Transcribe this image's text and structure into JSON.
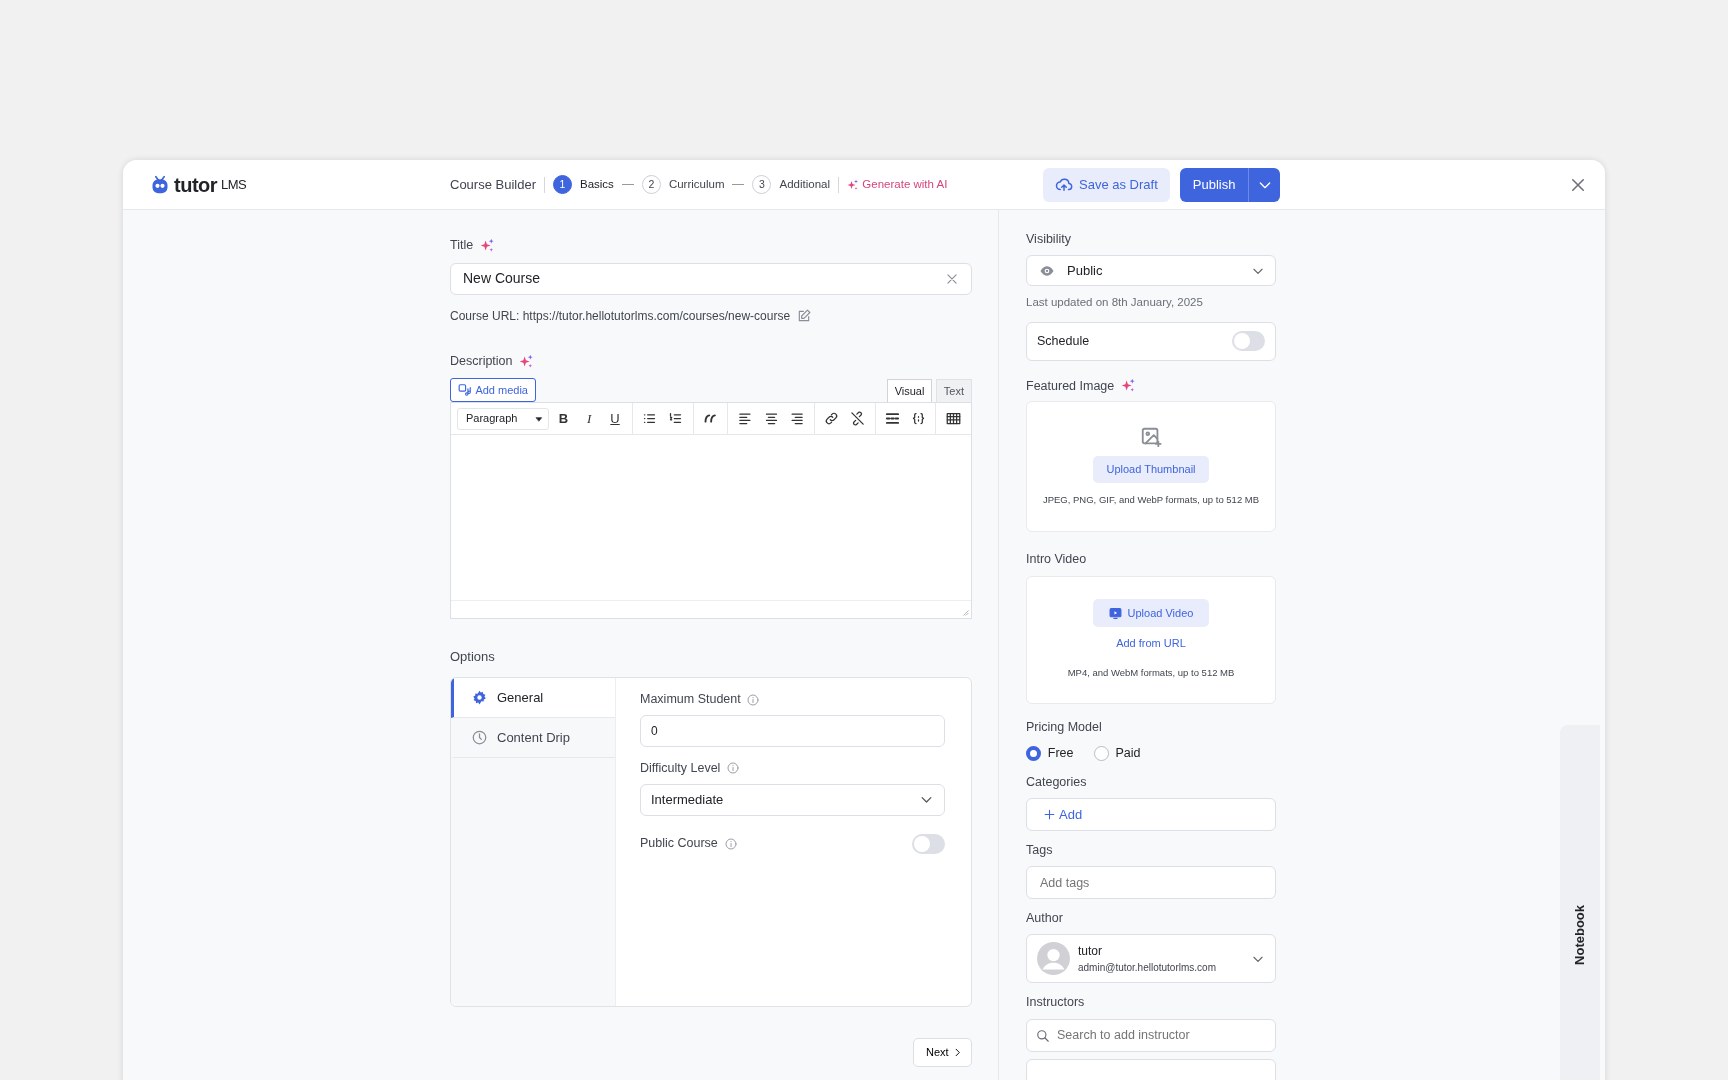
{
  "header": {
    "logo": "tutor",
    "logo_suffix": "LMS",
    "title": "Course Builder",
    "steps": [
      {
        "number": "1",
        "label": "Basics",
        "selected": true
      },
      {
        "number": "2",
        "label": "Curriculum",
        "selected": false
      },
      {
        "number": "3",
        "label": "Additional",
        "selected": false
      }
    ],
    "ai_button": "Generate with AI",
    "save_draft": "Save as Draft",
    "publish": "Publish"
  },
  "main": {
    "title_label": "Title",
    "title_value": "New Course",
    "course_url": "Course URL: https://tutor.hellotutorlms.com/courses/new-course",
    "description_label": "Description",
    "add_media": "Add media",
    "editor_tabs": [
      {
        "label": "Visual",
        "selected": true
      },
      {
        "label": "Text",
        "selected": false
      }
    ],
    "format_select": "Paragraph",
    "format_buttons": [
      "B",
      "I",
      "U"
    ],
    "options_label": "Options",
    "option_tabs": [
      {
        "label": "General",
        "selected": true
      },
      {
        "label": "Content Drip",
        "selected": false
      }
    ],
    "max_student_label": "Maximum Student",
    "max_student_value": "0",
    "difficulty_label": "Difficulty Level",
    "difficulty_value": "Intermediate",
    "public_course_label": "Public Course",
    "public_course_on": false,
    "next_button": "Next"
  },
  "sidebar": {
    "visibility_label": "Visibility",
    "visibility_value": "Public",
    "last_updated": "Last updated on 8th January, 2025",
    "schedule_label": "Schedule",
    "schedule_on": false,
    "featured_image_label": "Featured Image",
    "upload_thumbnail": "Upload Thumbnail",
    "image_formats": "JPEG, PNG, GIF, and WebP formats, up to 512 MB",
    "intro_video_label": "Intro Video",
    "upload_video": "Upload Video",
    "add_from_url": "Add from URL",
    "video_formats": "MP4, and WebM formats, up to 512 MB",
    "pricing_label": "Pricing Model",
    "pricing_options": [
      {
        "label": "Free",
        "selected": true
      },
      {
        "label": "Paid",
        "selected": false
      }
    ],
    "categories_label": "Categories",
    "categories_add": "Add",
    "tags_label": "Tags",
    "tags_placeholder": "Add tags",
    "author_label": "Author",
    "author_name": "tutor",
    "author_email": "admin@tutor.hellotutorlms.com",
    "instructors_label": "Instructors",
    "instructors_placeholder": "Search to add instructor"
  },
  "notebook_tab": "Notebook"
}
